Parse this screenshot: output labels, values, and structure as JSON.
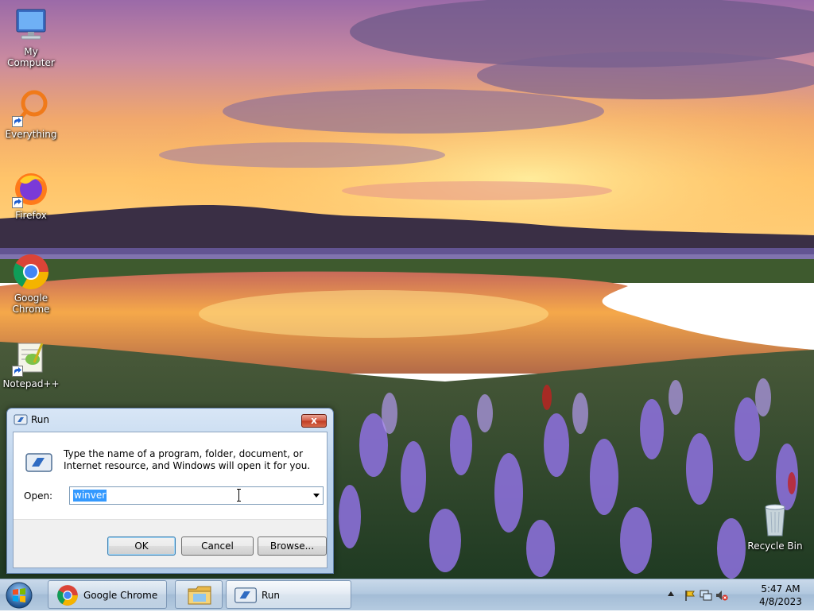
{
  "desktop": {
    "icons": [
      {
        "label": "My Computer",
        "icon": "computer-icon"
      },
      {
        "label": "Everything",
        "icon": "everything-icon"
      },
      {
        "label": "Firefox",
        "icon": "firefox-icon"
      },
      {
        "label": "Google Chrome",
        "icon": "chrome-icon"
      },
      {
        "label": "Notepad++",
        "icon": "notepadpp-icon"
      },
      {
        "label": "Recycle Bin",
        "icon": "recycle-bin-icon"
      }
    ]
  },
  "run_dialog": {
    "title": "Run",
    "close_label": "x",
    "description": "Type the name of a program, folder, document, or Internet resource, and Windows will open it for you.",
    "open_label": "Open:",
    "open_value": "winver",
    "ok_label": "OK",
    "cancel_label": "Cancel",
    "browse_label": "Browse..."
  },
  "taskbar": {
    "items": [
      {
        "label": "Google Chrome",
        "icon": "chrome-icon"
      },
      {
        "label": "",
        "icon": "folder-icon"
      },
      {
        "label": "Run",
        "icon": "run-icon"
      }
    ],
    "clock": {
      "time": "5:47 AM",
      "date": "4/8/2023"
    }
  },
  "colors": {
    "accent": "#3399ff",
    "close_red": "#c03b22",
    "taskbar": "#b2c8df"
  }
}
